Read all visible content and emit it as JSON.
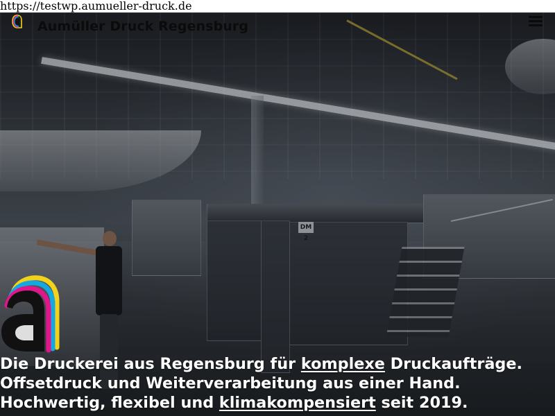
{
  "browser": {
    "url": "https://testwp.aumueller-druck.de"
  },
  "header": {
    "site_title": "Aumüller Druck Regensburg",
    "menu_icon": "hamburger-menu-icon",
    "logo_icon": "aumueller-a-logo-icon"
  },
  "hero": {
    "press_label": "DM 2",
    "headline": {
      "line1_pre": "Die Druckerei aus Regensburg für ",
      "line1_link": "komplexe",
      "line1_post": " Druckaufträge.",
      "line2": "Offsetdruck und Weiterverarbeitung aus einer Hand.",
      "line3_pre": "Hochwertig, flexibel und ",
      "line3_link": "klimakompensiert",
      "line3_post": " seit 2019."
    }
  },
  "colors": {
    "brand_yellow": "#f2d21a",
    "brand_magenta": "#e0168a",
    "brand_cyan": "#15a8e0",
    "title_text": "#0b0b0b",
    "headline_text": "#ffffff"
  }
}
